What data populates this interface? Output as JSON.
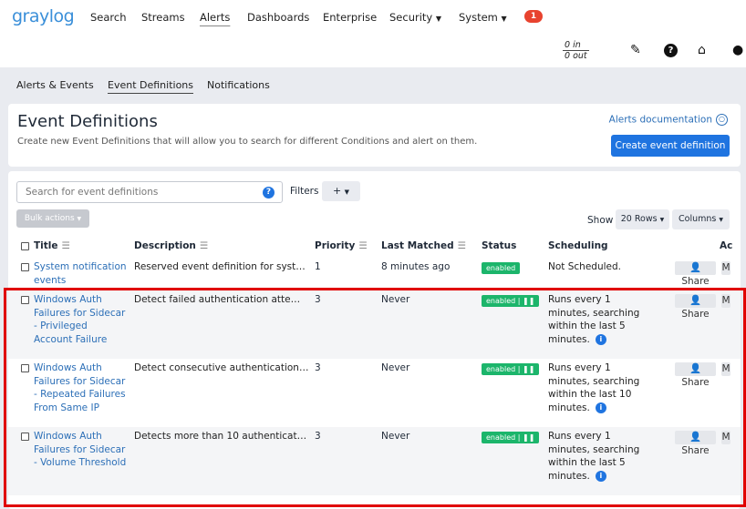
{
  "topnav": {
    "logo": "graylog",
    "items": [
      "Search",
      "Streams",
      "Alerts",
      "Dashboards",
      "Enterprise",
      "Security",
      "System"
    ],
    "active": "Alerts",
    "notification_count": "1",
    "throughput_in": "0 in",
    "throughput_out": "0 out",
    "icons": [
      "edit-icon",
      "help-icon",
      "home-icon",
      "user-icon"
    ]
  },
  "subnav": {
    "items": [
      "Alerts & Events",
      "Event Definitions",
      "Notifications"
    ],
    "active": "Event Definitions"
  },
  "header": {
    "title": "Event Definitions",
    "subtitle": "Create new Event Definitions that will allow you to search for different Conditions and alert on them.",
    "docs_link": "Alerts documentation",
    "create_button": "Create event definition"
  },
  "toolbar": {
    "search_placeholder": "Search for event definitions",
    "filters_label": "Filters",
    "filters_add": "+",
    "bulk_actions": "Bulk actions",
    "show_label": "Show",
    "rows_select": "20 Rows",
    "columns_select": "Columns"
  },
  "table": {
    "columns": [
      "Title",
      "Description",
      "Priority",
      "Last Matched",
      "Status",
      "Scheduling",
      "Ac"
    ],
    "share_label": "Share",
    "rows": [
      {
        "title": "System notification events",
        "description": "Reserved event definition for system ...",
        "priority": "1",
        "last_matched": "8 minutes ago",
        "status": "enabled",
        "scheduling": "Not Scheduled."
      },
      {
        "title": "Windows Auth Failures for Sidecar - Privileged Account Failure",
        "description": "Detect failed authentication attempt...",
        "priority": "3",
        "last_matched": "Never",
        "status": "enabled",
        "scheduling": "Runs every 1 minutes, searching within the last 5 minutes."
      },
      {
        "title": "Windows Auth Failures for Sidecar - Repeated Failures From Same IP",
        "description": "Detect consecutive authentication fa...",
        "priority": "3",
        "last_matched": "Never",
        "status": "enabled",
        "scheduling": "Runs every 1 minutes, searching within the last 10 minutes."
      },
      {
        "title": "Windows Auth Failures for Sidecar - Volume Threshold",
        "description": "Detects more than 10 authentication...",
        "priority": "3",
        "last_matched": "Never",
        "status": "enabled",
        "scheduling": "Runs every 1 minutes, searching within the last 5 minutes."
      }
    ]
  },
  "colors": {
    "brand": "#3a8fd9",
    "primary": "#1f74e0",
    "enabled": "#1cb56b",
    "highlight": "#e00000"
  }
}
